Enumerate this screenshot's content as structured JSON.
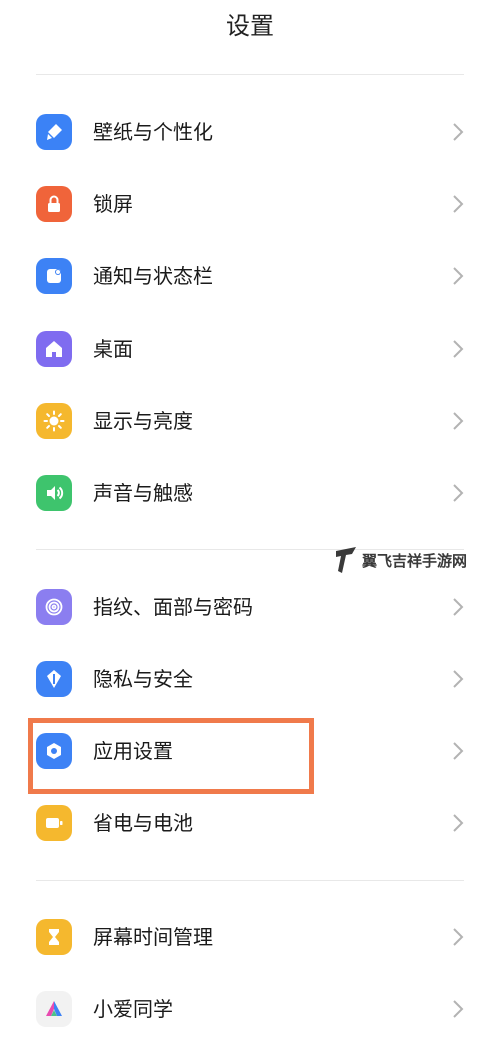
{
  "header": {
    "title": "设置"
  },
  "watermark": {
    "text": "翼飞吉祥手游网"
  },
  "groups": [
    {
      "items": [
        {
          "label": "壁纸与个性化",
          "icon": "brush-icon",
          "color": "#3b82f6"
        },
        {
          "label": "锁屏",
          "icon": "lock-icon",
          "color": "#f0643a"
        },
        {
          "label": "通知与状态栏",
          "icon": "notification-icon",
          "color": "#3d82f5"
        },
        {
          "label": "桌面",
          "icon": "home-icon",
          "color": "#7f6cf0"
        },
        {
          "label": "显示与亮度",
          "icon": "sun-icon",
          "color": "#f5b82e"
        },
        {
          "label": "声音与触感",
          "icon": "speaker-icon",
          "color": "#3ec46d"
        }
      ]
    },
    {
      "items": [
        {
          "label": "指纹、面部与密码",
          "icon": "fingerprint-icon",
          "color": "#8b7ef0"
        },
        {
          "label": "隐私与安全",
          "icon": "privacy-shield-icon",
          "color": "#3d82f5"
        },
        {
          "label": "应用设置",
          "icon": "app-settings-icon",
          "color": "#3d82f5"
        },
        {
          "label": "省电与电池",
          "icon": "battery-icon",
          "color": "#f5b82e"
        }
      ]
    },
    {
      "items": [
        {
          "label": "屏幕时间管理",
          "icon": "hourglass-icon",
          "color": "#f5b82e"
        },
        {
          "label": "小爱同学",
          "icon": "xiaoai-icon",
          "color": "#f2f2f2"
        }
      ]
    }
  ]
}
